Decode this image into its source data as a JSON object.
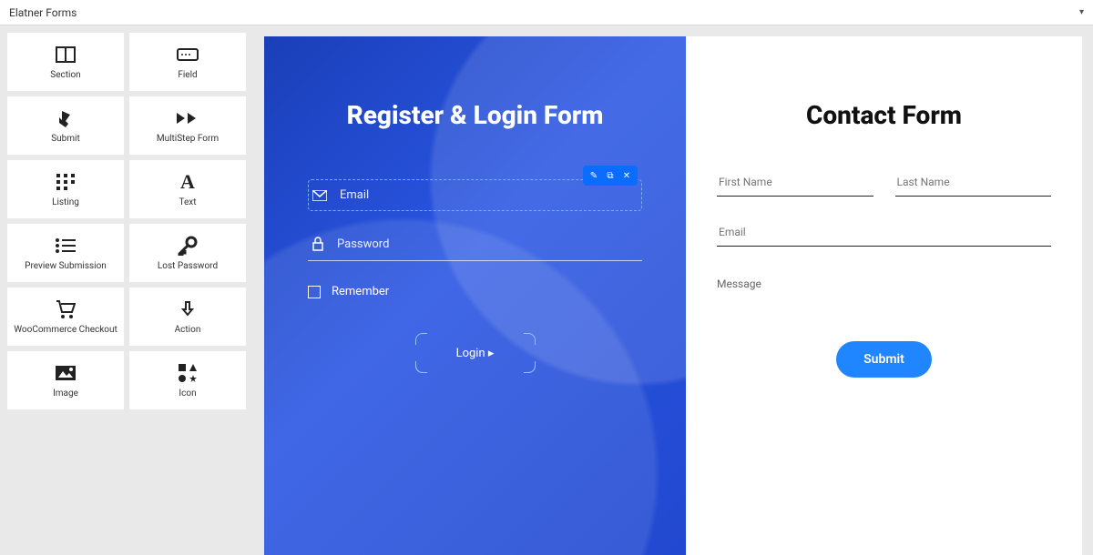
{
  "topbar": {
    "title": "Elatner Forms"
  },
  "widgets": [
    {
      "icon": "section-icon",
      "label": "Section"
    },
    {
      "icon": "field-icon",
      "label": "Field"
    },
    {
      "icon": "submit-icon",
      "label": "Submit"
    },
    {
      "icon": "multistep-icon",
      "label": "MultiStep Form"
    },
    {
      "icon": "grid-icon",
      "label": "Listing"
    },
    {
      "icon": "text-icon",
      "label": "Text"
    },
    {
      "icon": "list-icon",
      "label": "Preview Submission"
    },
    {
      "icon": "key-icon",
      "label": "Lost Password"
    },
    {
      "icon": "cart-icon",
      "label": "WooCommerce Checkout"
    },
    {
      "icon": "action-icon",
      "label": "Action"
    },
    {
      "icon": "image-icon",
      "label": "Image"
    },
    {
      "icon": "icon-icon",
      "label": "Icon"
    }
  ],
  "login_form": {
    "title": "Register & Login Form",
    "email_placeholder": "Email",
    "password_placeholder": "Password",
    "remember_label": "Remember",
    "button_label": "Login ▸"
  },
  "contact_form": {
    "title": "Contact Form",
    "first_name": "First Name",
    "last_name": "Last Name",
    "email": "Email",
    "message": "Message",
    "submit": "Submit"
  }
}
